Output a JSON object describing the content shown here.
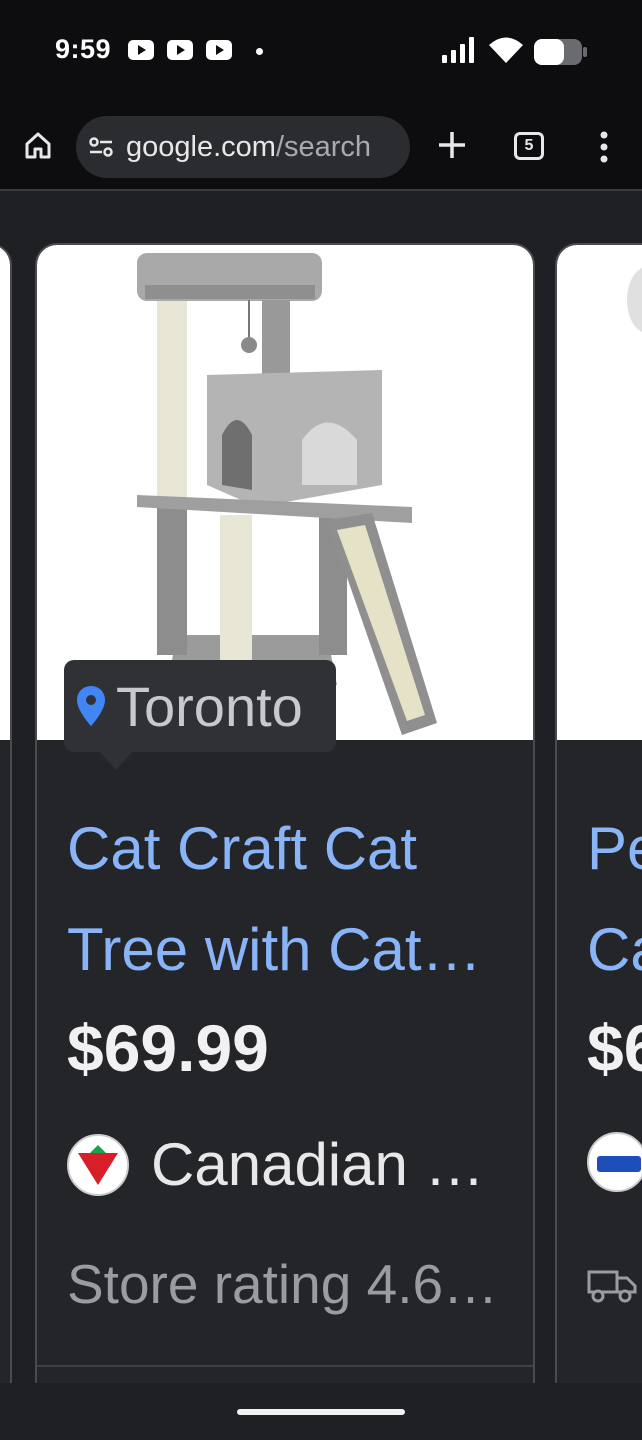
{
  "status_bar": {
    "time": "9:59",
    "notification_icons": [
      "youtube-icon",
      "youtube-icon",
      "youtube-icon"
    ],
    "signal_icon": "signal-icon",
    "wifi_icon": "wifi-icon",
    "battery_icon": "battery-icon"
  },
  "browser": {
    "url_host": "google.com",
    "url_path": "/search",
    "tab_count": "5",
    "icons": {
      "home": "home-icon",
      "site_info": "tune-icon",
      "new_tab": "plus-icon",
      "menu": "more-vert-icon"
    }
  },
  "product_card": {
    "location": "Toronto",
    "title_line1": "Cat Craft Cat",
    "title_line2": "Tree with Cat…",
    "price": "$69.99",
    "store": "Canadian …",
    "rating": "Store rating 4.6…"
  },
  "next_card": {
    "title_line1": "Pe",
    "title_line2": "Ca",
    "price": "$6"
  },
  "colors": {
    "link_blue": "#8ab4f8",
    "card_bg": "#242529",
    "page_bg": "#1f2024",
    "pin_blue": "#4285f4",
    "maple_red": "#d81e28"
  }
}
